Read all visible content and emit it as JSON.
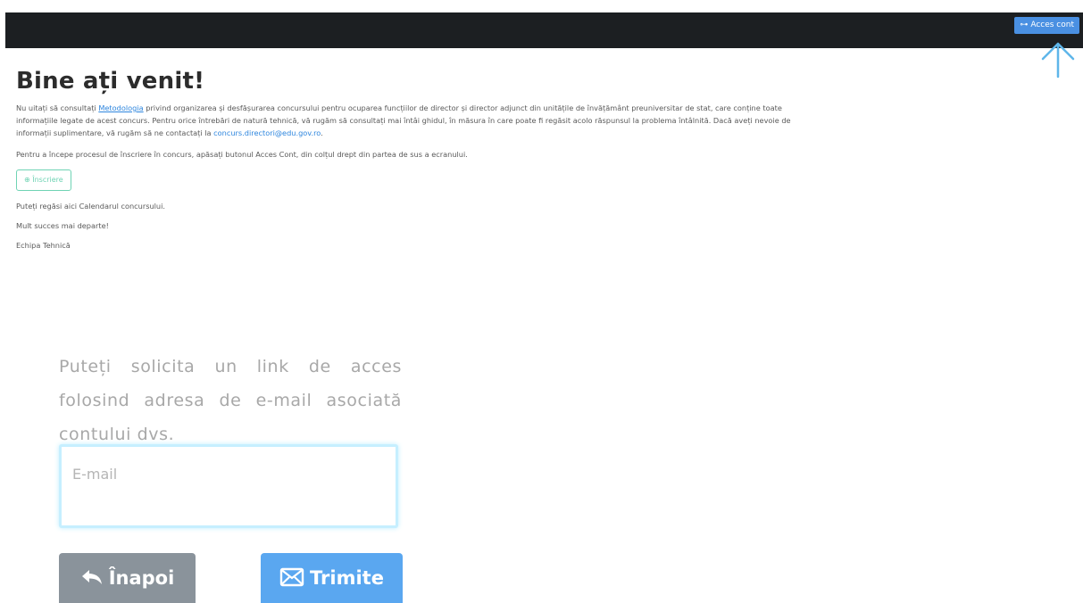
{
  "header": {
    "acces_cont_label": "Acces cont"
  },
  "welcome": {
    "title": "Bine ați venit!",
    "p1_before_link": "Nu uitați să consultați ",
    "p1_link": "Metodologia",
    "p1_after_link": " privind organizarea și desfășurarea concursului pentru ocuparea funcțiilor de director și director adjunct din unitățile de învățământ preuniversitar de stat, care conține toate informațiile legate de acest concurs. Pentru orice întrebări de natură tehnică, vă rugăm să consultați mai întâi ghidul, în măsura în care poate fi regăsit acolo răspunsul la problema întâlnită. Dacă aveți nevoie de informații suplimentare, vă rugăm să ne contactați la ",
    "p1_email": "concurs.directori@edu.gov.ro",
    "p1_end": ".",
    "p2": "Pentru a începe procesul de înscriere în concurs, apăsați butonul Acces Cont, din colțul drept din partea de sus a ecranului.",
    "inscriere_label": "Înscriere",
    "calendar_text": "Puteți regăsi aici Calendarul concursului.",
    "succes_text": "Mult succes mai departe!",
    "signature": "Echipa Tehnică"
  },
  "request": {
    "text": "Puteți solicita un link de acces folosind adresa de e-mail asociată contului dvs.",
    "email_placeholder": "E-mail",
    "back_label": "Înapoi",
    "send_label": "Trimite"
  },
  "colors": {
    "topbar": "#1c1f22",
    "accent": "#4a90e2",
    "back_button": "#8a939b",
    "send_button": "#5aa7f0",
    "inscriere": "#6fd3b4"
  },
  "icons": {
    "acces": "key-icon",
    "inscriere": "user-plus-icon",
    "back": "reply-icon",
    "send": "envelope-icon",
    "annotation": "up-arrow-icon"
  }
}
